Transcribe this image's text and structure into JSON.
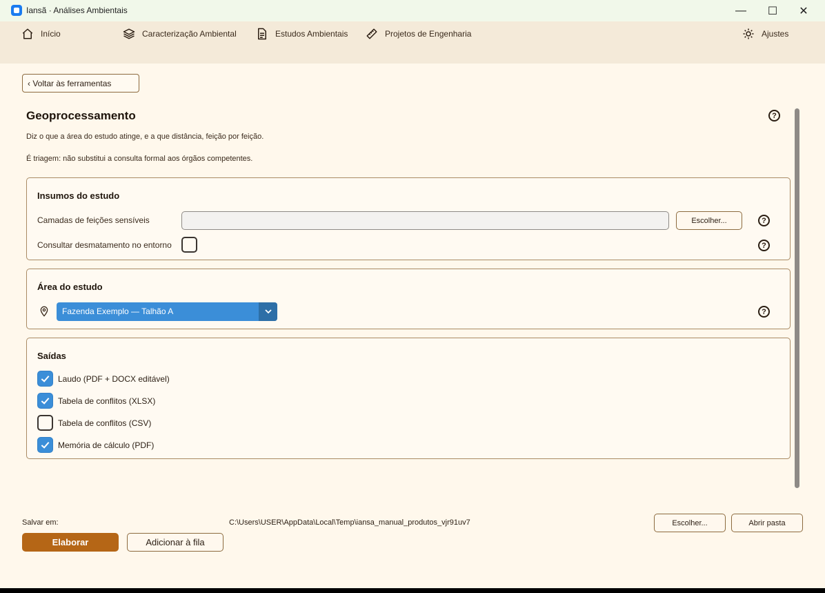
{
  "window": {
    "title": "Iansã · Análises Ambientais",
    "minimize_glyph": "—",
    "maximize_glyph": "☐",
    "close_glyph": "✕"
  },
  "nav": {
    "home": "Início",
    "caracterizacao": "Caracterização Ambiental",
    "estudos": "Estudos Ambientais",
    "projetos": "Projetos de Engenharia",
    "ajustes": "Ajustes"
  },
  "back_button": "‹ Voltar às ferramentas",
  "page": {
    "title": "Geoprocessamento",
    "description": "Diz o que a área do estudo atinge, e a que distância, feição por feição.",
    "note": "É triagem: não substitui a consulta formal aos órgãos competentes."
  },
  "insumos": {
    "title": "Insumos do estudo",
    "camadas_label": "Camadas de feições sensíveis",
    "camadas_value": "",
    "escolher_label": "Escolher...",
    "desmatamento_label": "Consultar desmatamento no entorno",
    "desmatamento_checked": false
  },
  "area": {
    "title": "Área do estudo",
    "selected": "Fazenda Exemplo — Talhão A"
  },
  "saidas": {
    "title": "Saídas",
    "items": [
      {
        "label": "Laudo (PDF + DOCX editável)",
        "checked": true
      },
      {
        "label": "Tabela de conflitos (XLSX)",
        "checked": true
      },
      {
        "label": "Tabela de conflitos (CSV)",
        "checked": false
      },
      {
        "label": "Memória de cálculo (PDF)",
        "checked": true
      }
    ]
  },
  "footer": {
    "save_label": "Salvar em:",
    "save_path": "C:\\Users\\USER\\AppData\\Local\\Temp\\iansa_manual_produtos_vjr91uv7",
    "escolher_label": "Escolher...",
    "abrir_pasta_label": "Abrir pasta",
    "elaborar_label": "Elaborar",
    "adicionar_fila_label": "Adicionar à fila"
  },
  "colors": {
    "accent_blue": "#3b8ed8",
    "primary_orange": "#b56616",
    "background": "#fff8ec"
  }
}
